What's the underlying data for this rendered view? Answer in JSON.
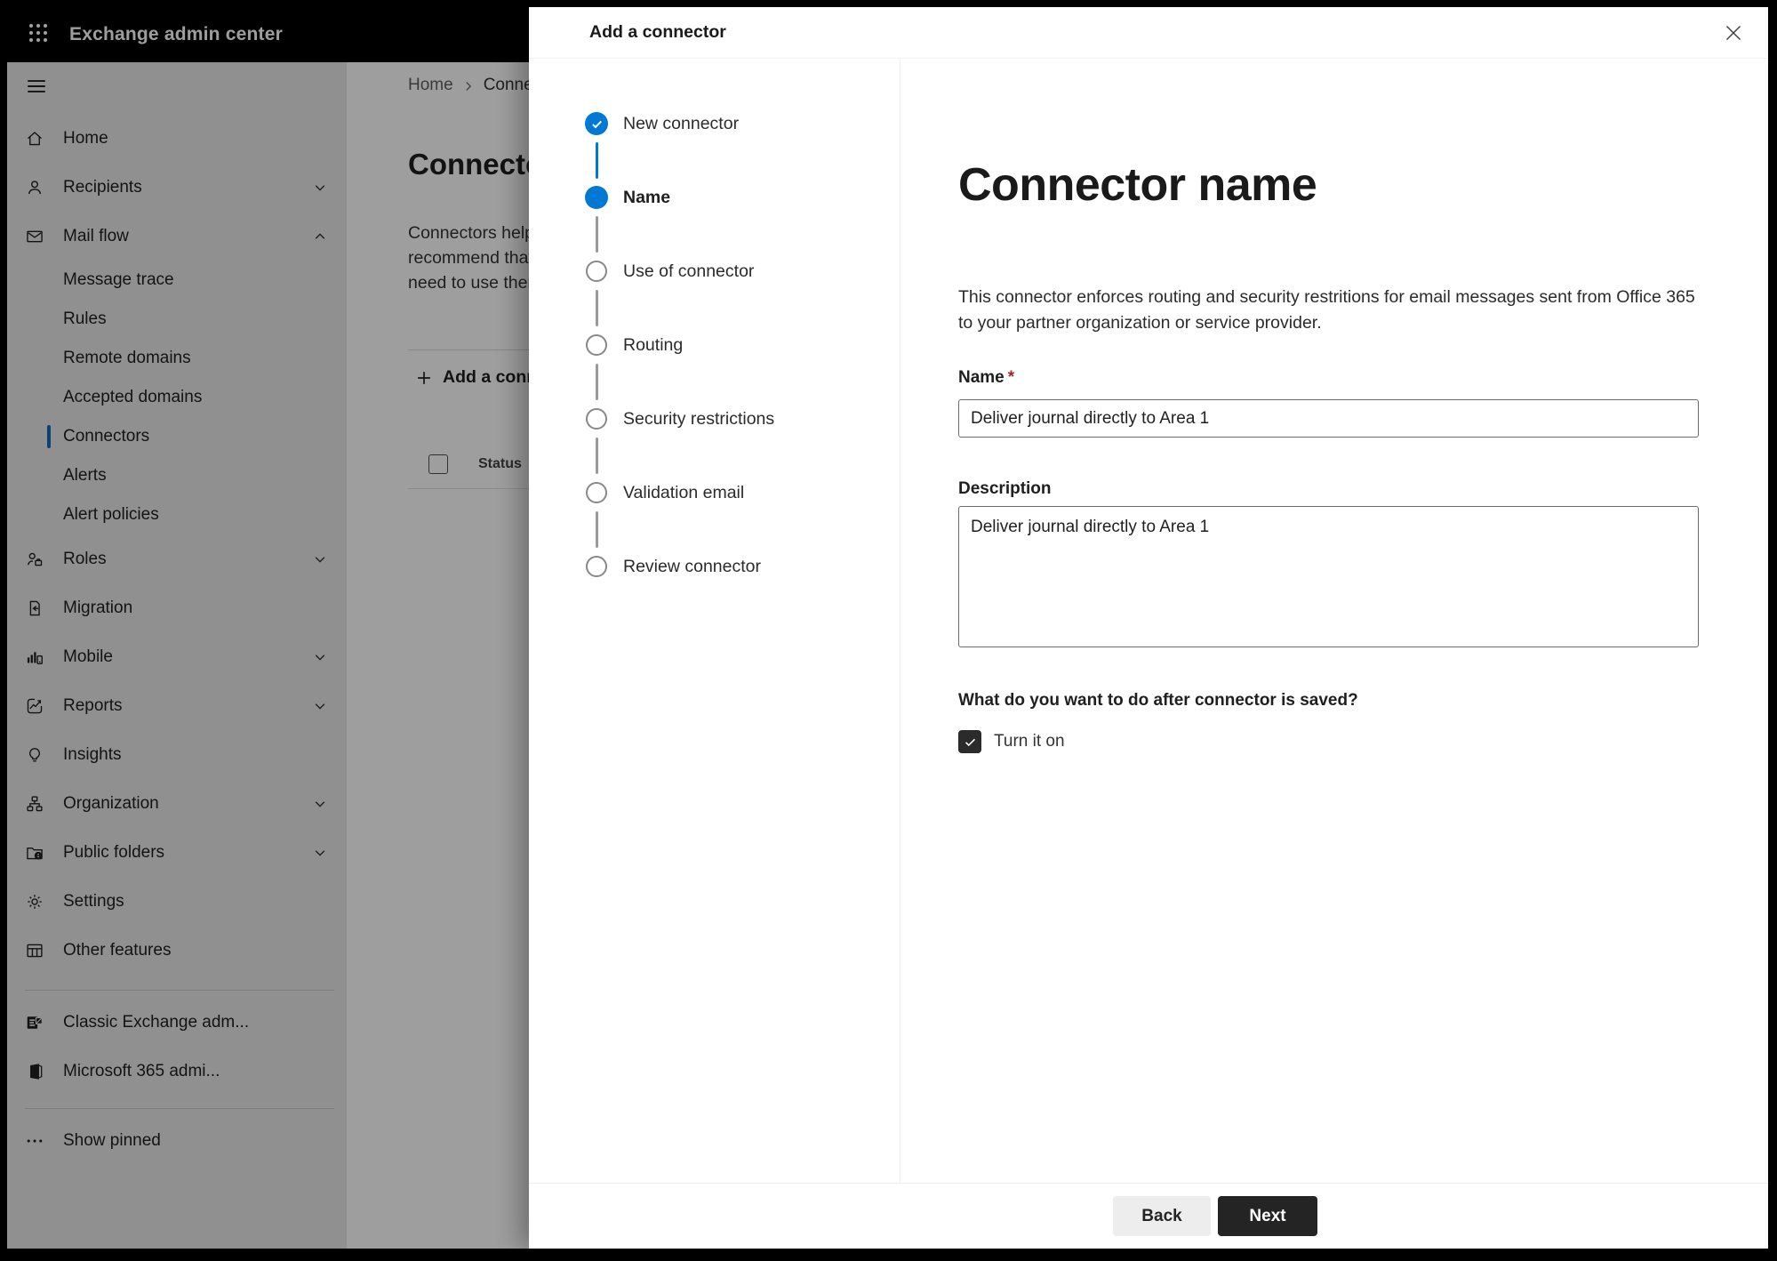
{
  "app": {
    "title": "Exchange admin center"
  },
  "sidebar": {
    "items": [
      {
        "label": "Home",
        "icon": "home-icon",
        "type": "parent"
      },
      {
        "label": "Recipients",
        "icon": "person-icon",
        "type": "parent",
        "chevron": "down"
      },
      {
        "label": "Mail flow",
        "icon": "mail-icon",
        "type": "parent",
        "chevron": "up"
      },
      {
        "label": "Message trace",
        "type": "sub"
      },
      {
        "label": "Rules",
        "type": "sub"
      },
      {
        "label": "Remote domains",
        "type": "sub"
      },
      {
        "label": "Accepted domains",
        "type": "sub"
      },
      {
        "label": "Connectors",
        "type": "sub",
        "selected": true
      },
      {
        "label": "Alerts",
        "type": "sub"
      },
      {
        "label": "Alert policies",
        "type": "sub"
      },
      {
        "label": "Roles",
        "icon": "roles-icon",
        "type": "parent",
        "chevron": "down"
      },
      {
        "label": "Migration",
        "icon": "migration-icon",
        "type": "parent"
      },
      {
        "label": "Mobile",
        "icon": "mobile-icon",
        "type": "parent",
        "chevron": "down"
      },
      {
        "label": "Reports",
        "icon": "reports-icon",
        "type": "parent",
        "chevron": "down"
      },
      {
        "label": "Insights",
        "icon": "insights-icon",
        "type": "parent"
      },
      {
        "label": "Organization",
        "icon": "organization-icon",
        "type": "parent",
        "chevron": "down"
      },
      {
        "label": "Public folders",
        "icon": "public-folders-icon",
        "type": "parent",
        "chevron": "down"
      },
      {
        "label": "Settings",
        "icon": "settings-icon",
        "type": "parent"
      },
      {
        "label": "Other features",
        "icon": "other-features-icon",
        "type": "parent"
      }
    ],
    "footer_items": [
      {
        "label": "Classic Exchange adm...",
        "icon": "classic-exchange-icon"
      },
      {
        "label": "Microsoft 365 admi...",
        "icon": "m365-icon"
      }
    ],
    "pinned": {
      "label": "Show pinned",
      "icon": "more-icon"
    }
  },
  "background_page": {
    "breadcrumb": {
      "home": "Home",
      "current": "Connectors"
    },
    "title": "Connectors",
    "paragraph_lines": [
      "Connectors help",
      "recommend that",
      "need to use ther"
    ],
    "add_button": "Add a connector",
    "table": {
      "status_header": "Status"
    }
  },
  "dialog": {
    "title": "Add a connector",
    "steps": [
      {
        "label": "New connector",
        "state": "completed"
      },
      {
        "label": "Name",
        "state": "current"
      },
      {
        "label": "Use of connector",
        "state": "upcoming"
      },
      {
        "label": "Routing",
        "state": "upcoming"
      },
      {
        "label": "Security restrictions",
        "state": "upcoming"
      },
      {
        "label": "Validation email",
        "state": "upcoming"
      },
      {
        "label": "Review connector",
        "state": "upcoming"
      }
    ],
    "content": {
      "heading": "Connector name",
      "description_lines": [
        "This connector enforces routing and security restritions for email messages sent from Office 365",
        "to your partner organization or service provider."
      ],
      "name_label": "Name",
      "required_mark": "*",
      "name_value": "Deliver journal directly to Area 1",
      "description_label": "Description",
      "description_value": "Deliver journal directly to Area 1",
      "after_save_question": "What do you want to do after connector is saved?",
      "turn_on_label": "Turn it on",
      "turn_on_checked": true
    },
    "footer": {
      "back": "Back",
      "next": "Next"
    }
  },
  "colors": {
    "accent": "#0078d4",
    "topbar_bg": "#000000",
    "sidebar_bg": "#e9e9e9",
    "selected_indicator": "#0f6cbd",
    "step_pending": "#8a8886",
    "next_button_bg": "#242424",
    "back_button_bg": "#ededed",
    "required": "#a4262c",
    "overlay": "rgba(0,0,0,0.38)"
  }
}
